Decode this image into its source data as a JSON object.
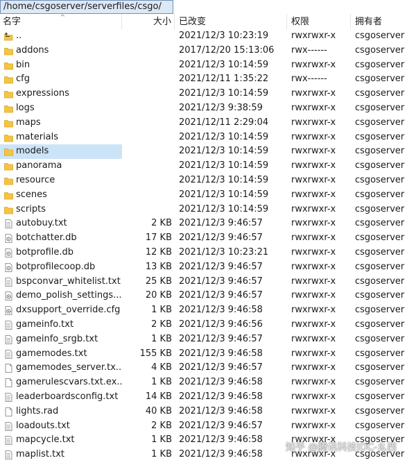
{
  "path": "/home/csgoserver/serverfiles/csgo/",
  "columns": {
    "name": "名字",
    "size": "大小",
    "modified": "已改变",
    "permissions": "权限",
    "owner": "拥有者"
  },
  "files": [
    {
      "name": "..",
      "size": "",
      "modified": "2021/12/3 10:23:19",
      "permissions": "rwxrwxr-x",
      "owner": "csgoserver",
      "icon": "parent-folder-icon"
    },
    {
      "name": "addons",
      "size": "",
      "modified": "2017/12/20 15:13:06",
      "permissions": "rwx------",
      "owner": "csgoserver",
      "icon": "folder-icon"
    },
    {
      "name": "bin",
      "size": "",
      "modified": "2021/12/3 10:14:59",
      "permissions": "rwxrwxr-x",
      "owner": "csgoserver",
      "icon": "folder-icon"
    },
    {
      "name": "cfg",
      "size": "",
      "modified": "2021/12/11 1:35:22",
      "permissions": "rwx------",
      "owner": "csgoserver",
      "icon": "folder-icon"
    },
    {
      "name": "expressions",
      "size": "",
      "modified": "2021/12/3 10:14:59",
      "permissions": "rwxrwxr-x",
      "owner": "csgoserver",
      "icon": "folder-icon"
    },
    {
      "name": "logs",
      "size": "",
      "modified": "2021/12/3 9:38:59",
      "permissions": "rwxrwxr-x",
      "owner": "csgoserver",
      "icon": "folder-icon"
    },
    {
      "name": "maps",
      "size": "",
      "modified": "2021/12/11 2:29:04",
      "permissions": "rwxrwxr-x",
      "owner": "csgoserver",
      "icon": "folder-icon"
    },
    {
      "name": "materials",
      "size": "",
      "modified": "2021/12/3 10:14:59",
      "permissions": "rwxrwxr-x",
      "owner": "csgoserver",
      "icon": "folder-icon"
    },
    {
      "name": "models",
      "size": "",
      "modified": "2021/12/3 10:14:59",
      "permissions": "rwxrwxr-x",
      "owner": "csgoserver",
      "icon": "folder-icon",
      "selected": true
    },
    {
      "name": "panorama",
      "size": "",
      "modified": "2021/12/3 10:14:59",
      "permissions": "rwxrwxr-x",
      "owner": "csgoserver",
      "icon": "folder-icon"
    },
    {
      "name": "resource",
      "size": "",
      "modified": "2021/12/3 10:14:59",
      "permissions": "rwxrwxr-x",
      "owner": "csgoserver",
      "icon": "folder-icon"
    },
    {
      "name": "scenes",
      "size": "",
      "modified": "2021/12/3 10:14:59",
      "permissions": "rwxrwxr-x",
      "owner": "csgoserver",
      "icon": "folder-icon"
    },
    {
      "name": "scripts",
      "size": "",
      "modified": "2021/12/3 10:14:59",
      "permissions": "rwxrwxr-x",
      "owner": "csgoserver",
      "icon": "folder-icon"
    },
    {
      "name": "autobuy.txt",
      "size": "2 KB",
      "modified": "2021/12/3 9:46:57",
      "permissions": "rwxrwxr-x",
      "owner": "csgoserver",
      "icon": "text-file-icon"
    },
    {
      "name": "botchatter.db",
      "size": "17 KB",
      "modified": "2021/12/3 9:46:57",
      "permissions": "rwxrwxr-x",
      "owner": "csgoserver",
      "icon": "db-file-icon"
    },
    {
      "name": "botprofile.db",
      "size": "12 KB",
      "modified": "2021/12/3 10:23:21",
      "permissions": "rwxrwxr-x",
      "owner": "csgoserver",
      "icon": "db-file-icon"
    },
    {
      "name": "botprofilecoop.db",
      "size": "13 KB",
      "modified": "2021/12/3 9:46:57",
      "permissions": "rwxrwxr-x",
      "owner": "csgoserver",
      "icon": "db-file-icon"
    },
    {
      "name": "bspconvar_whitelist.txt",
      "size": "25 KB",
      "modified": "2021/12/3 9:46:57",
      "permissions": "rwxrwxr-x",
      "owner": "csgoserver",
      "icon": "text-file-icon"
    },
    {
      "name": "demo_polish_settings...",
      "size": "20 KB",
      "modified": "2021/12/3 9:46:57",
      "permissions": "rwxrwxr-x",
      "owner": "csgoserver",
      "icon": "settings-file-icon"
    },
    {
      "name": "dxsupport_override.cfg",
      "size": "1 KB",
      "modified": "2021/12/3 9:46:58",
      "permissions": "rwxrwxr-x",
      "owner": "csgoserver",
      "icon": "settings-file-icon"
    },
    {
      "name": "gameinfo.txt",
      "size": "2 KB",
      "modified": "2021/12/3 9:46:56",
      "permissions": "rwxrwxr-x",
      "owner": "csgoserver",
      "icon": "text-file-icon"
    },
    {
      "name": "gameinfo_srgb.txt",
      "size": "1 KB",
      "modified": "2021/12/3 9:46:57",
      "permissions": "rwxrwxr-x",
      "owner": "csgoserver",
      "icon": "text-file-icon"
    },
    {
      "name": "gamemodes.txt",
      "size": "155 KB",
      "modified": "2021/12/3 9:46:58",
      "permissions": "rwxrwxr-x",
      "owner": "csgoserver",
      "icon": "text-file-icon"
    },
    {
      "name": "gamemodes_server.tx...",
      "size": "4 KB",
      "modified": "2021/12/3 9:46:57",
      "permissions": "rwxrwxr-x",
      "owner": "csgoserver",
      "icon": "blank-file-icon"
    },
    {
      "name": "gamerulescvars.txt.ex...",
      "size": "1 KB",
      "modified": "2021/12/3 9:46:58",
      "permissions": "rwxrwxr-x",
      "owner": "csgoserver",
      "icon": "blank-file-icon"
    },
    {
      "name": "leaderboardsconfig.txt",
      "size": "14 KB",
      "modified": "2021/12/3 9:46:58",
      "permissions": "rwxrwxr-x",
      "owner": "csgoserver",
      "icon": "text-file-icon"
    },
    {
      "name": "lights.rad",
      "size": "40 KB",
      "modified": "2021/12/3 9:46:58",
      "permissions": "rwxrwxr-x",
      "owner": "csgoserver",
      "icon": "blank-file-icon"
    },
    {
      "name": "loadouts.txt",
      "size": "2 KB",
      "modified": "2021/12/3 9:46:57",
      "permissions": "rwxrwxr-x",
      "owner": "csgoserver",
      "icon": "text-file-icon"
    },
    {
      "name": "mapcycle.txt",
      "size": "1 KB",
      "modified": "2021/12/3 9:46:58",
      "permissions": "rwxrwxr-x",
      "owner": "csgoserver",
      "icon": "text-file-icon"
    },
    {
      "name": "maplist.txt",
      "size": "1 KB",
      "modified": "2021/12/3 9:46:58",
      "permissions": "rwxrwxr-x",
      "owner": "csgoserver",
      "icon": "text-file-icon"
    }
  ],
  "watermark": "知乎 @腾讯科技IDC-幺西",
  "colors": {
    "folder": "#f5c542",
    "selection": "#cce4f7",
    "pathbar_bg": "#dde8f5"
  }
}
